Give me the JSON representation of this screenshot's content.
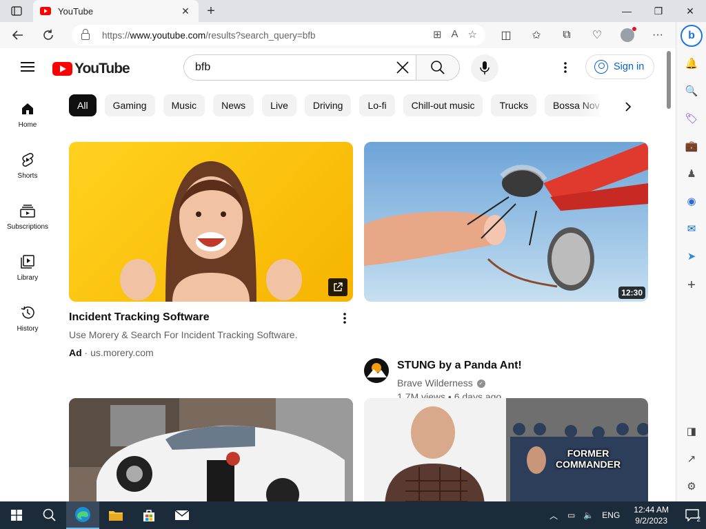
{
  "browser": {
    "tab_title": "YouTube",
    "url_prefix": "https://",
    "url_domain": "www.youtube.com",
    "url_path": "/results?search_query=bfb"
  },
  "youtube": {
    "logo_text": "YouTube",
    "search_value": "bfb",
    "signin_label": "Sign in",
    "guide": [
      {
        "label": "Home",
        "icon": "home-icon"
      },
      {
        "label": "Shorts",
        "icon": "shorts-icon"
      },
      {
        "label": "Subscriptions",
        "icon": "subscriptions-icon"
      },
      {
        "label": "Library",
        "icon": "library-icon"
      },
      {
        "label": "History",
        "icon": "history-icon"
      }
    ],
    "chips": [
      "All",
      "Gaming",
      "Music",
      "News",
      "Live",
      "Driving",
      "Lo-fi",
      "Chill-out music",
      "Trucks",
      "Bossa Nova"
    ],
    "videos": [
      {
        "title": "Incident Tracking Software",
        "description": "Use Morery & Search For Incident Tracking Software.",
        "ad_label": "Ad",
        "ad_domain": "us.morery.com"
      },
      {
        "title": "STUNG by a Panda Ant!",
        "channel": "Brave Wilderness",
        "views": "1.7M views",
        "age": "6 days ago",
        "duration": "12:30"
      },
      {
        "thumbnail_caption": ""
      },
      {
        "thumbnail_caption_line1": "FORMER",
        "thumbnail_caption_line2": "COMMANDER"
      }
    ]
  },
  "taskbar": {
    "language": "ENG",
    "time": "12:44 AM",
    "date": "9/2/2023",
    "notifications": "2"
  },
  "colors": {
    "youtube_red": "#ff0000",
    "link_blue": "#065fd4",
    "taskbar_bg": "#1c2b3a"
  }
}
